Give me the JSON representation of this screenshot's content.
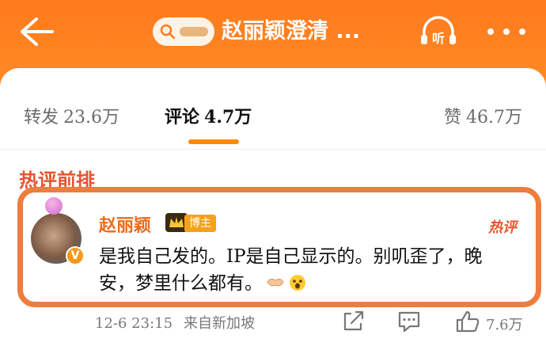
{
  "header": {
    "title": "赵丽颖澄清 ...",
    "listen_label": "听"
  },
  "tabs": [
    {
      "label": "转发",
      "count": "23.6万"
    },
    {
      "label": "评论",
      "count": "4.7万"
    },
    {
      "label": "赞",
      "count": "46.7万"
    }
  ],
  "section": {
    "title": "热评前排"
  },
  "comment": {
    "username": "赵丽颖",
    "role_badge": "博主",
    "verified_mark": "V",
    "hot_tag": "热评",
    "text": "是我自己发的。IP是自己显示的。别叽歪了，晚安，梦里什么都有。",
    "time": "12-6 23:15",
    "source": "来自新加坡",
    "like_count": "7.6万"
  },
  "colors": {
    "header_orange": "#ff7a1c",
    "accent_orange": "#ff8a00",
    "highlight_border": "#ee7d3f",
    "username_color": "#ef6b1b",
    "hot_red": "#e8542d"
  }
}
